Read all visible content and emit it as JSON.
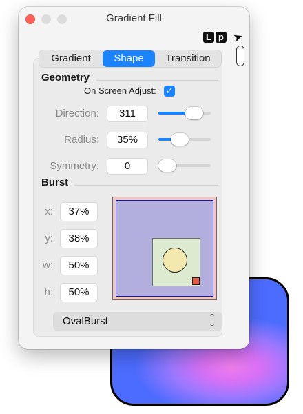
{
  "window": {
    "title": "Gradient Fill"
  },
  "brand": {
    "logo_letters": [
      "L",
      "p"
    ]
  },
  "tabs": [
    {
      "label": "Gradient",
      "active": false
    },
    {
      "label": "Shape",
      "active": true
    },
    {
      "label": "Transition",
      "active": false
    }
  ],
  "geometry": {
    "title": "Geometry",
    "on_screen_adjust_label": "On Screen Adjust:",
    "on_screen_adjust_checked": true,
    "direction": {
      "label": "Direction:",
      "value": "311",
      "slider_fraction": 0.78
    },
    "radius": {
      "label": "Radius:",
      "value": "35%",
      "slider_fraction": 0.35
    },
    "symmetry": {
      "label": "Symmetry:",
      "value": "0",
      "slider_fraction": 0.0
    }
  },
  "burst": {
    "title": "Burst",
    "x": {
      "label": "x:",
      "value": "37%"
    },
    "y": {
      "label": "y:",
      "value": "38%"
    },
    "w": {
      "label": "w:",
      "value": "50%"
    },
    "h": {
      "label": "h:",
      "value": "50%"
    },
    "shape_select": {
      "value": "OvalBurst"
    }
  },
  "colors": {
    "accent": "#1a84ff",
    "close_button": "#fe5f57",
    "burst_outer": "#edc9c5",
    "burst_inner": "#b2aede",
    "burst_border": "#1d14b8",
    "oval_box": "#dcebcf",
    "oval_fill": "#f3e8ad",
    "handle": "#e15a4a"
  },
  "icons": {
    "checkmark": "checkmark-icon",
    "chevrons": "up-down-chevron-icon",
    "pointer": "pointer-arrow-icon"
  }
}
